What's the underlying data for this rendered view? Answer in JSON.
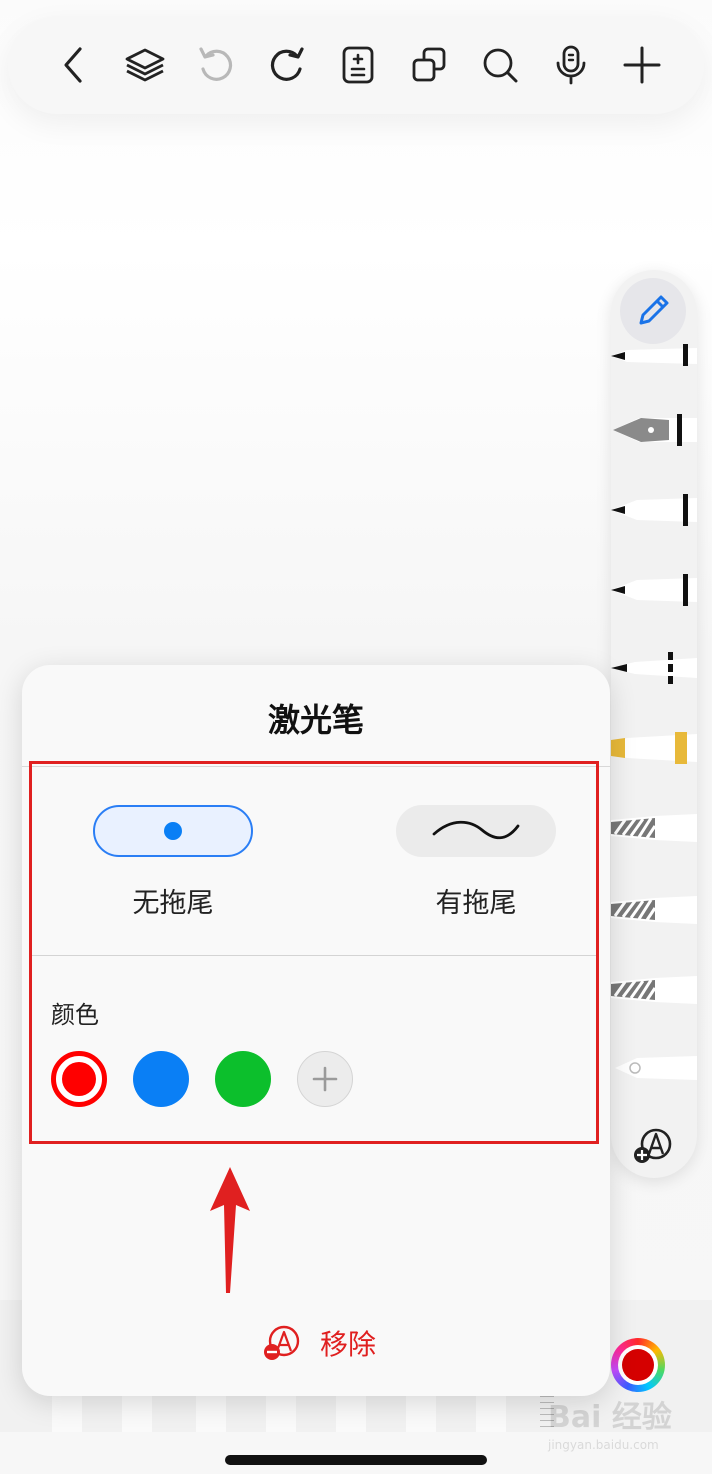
{
  "toolbar": {
    "icons": [
      "back-icon",
      "layers-icon",
      "undo-icon",
      "redo-icon",
      "page-format-icon",
      "duplicate-icon",
      "search-icon",
      "microphone-icon",
      "add-icon"
    ]
  },
  "pen_palette": {
    "tools": [
      "pencil-icon",
      "ballpoint-pen-icon",
      "fountain-pen-icon",
      "marker-icon",
      "brush-pen-icon",
      "fine-liner-icon",
      "highlighter-icon",
      "pattern-brush-icon",
      "pattern-brush-icon",
      "pattern-brush-icon",
      "laser-pen-icon"
    ],
    "highlighter_color": "#e8b93a",
    "add_icon": "add-tool-icon"
  },
  "current_color": "#d50000",
  "panel": {
    "title": "激光笔",
    "modes": [
      {
        "label": "无拖尾",
        "selected": true
      },
      {
        "label": "有拖尾",
        "selected": false
      }
    ],
    "color_heading": "颜色",
    "colors": [
      "#ff0000",
      "#0a7ff5",
      "#0cbf2c"
    ],
    "selected_color": "#ff0000",
    "remove_label": "移除",
    "accent": "#2a7ef5",
    "danger": "#e02020"
  },
  "watermark": {
    "main": "Bai 经验",
    "sub": "jingyan.baidu.com"
  }
}
